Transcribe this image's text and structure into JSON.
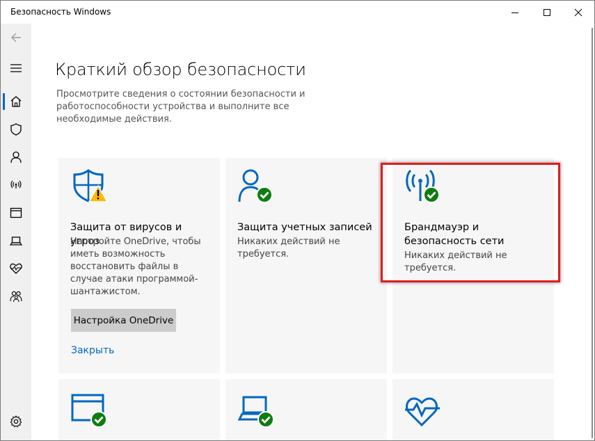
{
  "window": {
    "title": "Безопасность Windows",
    "controls": {
      "minimize": "minimize-icon",
      "maximize": "maximize-icon",
      "close": "close-icon"
    }
  },
  "sidebar": {
    "items": [
      {
        "icon": "back-arrow-icon"
      },
      {
        "icon": "menu-icon"
      },
      {
        "icon": "home-icon",
        "selected": true
      },
      {
        "icon": "shield-icon"
      },
      {
        "icon": "person-icon"
      },
      {
        "icon": "wifi-icon"
      },
      {
        "icon": "app-browser-icon"
      },
      {
        "icon": "laptop-icon"
      },
      {
        "icon": "heart-icon"
      },
      {
        "icon": "family-icon"
      },
      {
        "icon": "settings-icon"
      }
    ]
  },
  "page": {
    "title": "Краткий обзор безопасности",
    "description": "Просмотрите сведения о состоянии безопасности и работоспособности устройства и выполните все необходимые действия."
  },
  "cards": {
    "virus": {
      "title": "Защита от вирусов и угроз",
      "text": "Настройте OneDrive, чтобы иметь возможность восстановить файлы в случае атаки программой-шантажистом.",
      "button": "Настройка OneDrive",
      "link": "Закрыть",
      "status": "warning"
    },
    "account": {
      "title": "Защита учетных записей",
      "text": "Никаких действий не требуется.",
      "status": "ok"
    },
    "firewall": {
      "title": "Брандмауэр и безопасность сети",
      "text": "Никаких действий не требуется.",
      "status": "ok"
    },
    "app_browser": {
      "status": "ok"
    },
    "device_security": {
      "status": "ok"
    },
    "device_health": {
      "status": "ok"
    }
  },
  "colors": {
    "accent": "#0067c0",
    "ok": "#107c10",
    "warning": "#ffb900",
    "highlight": "#e01c1c"
  }
}
